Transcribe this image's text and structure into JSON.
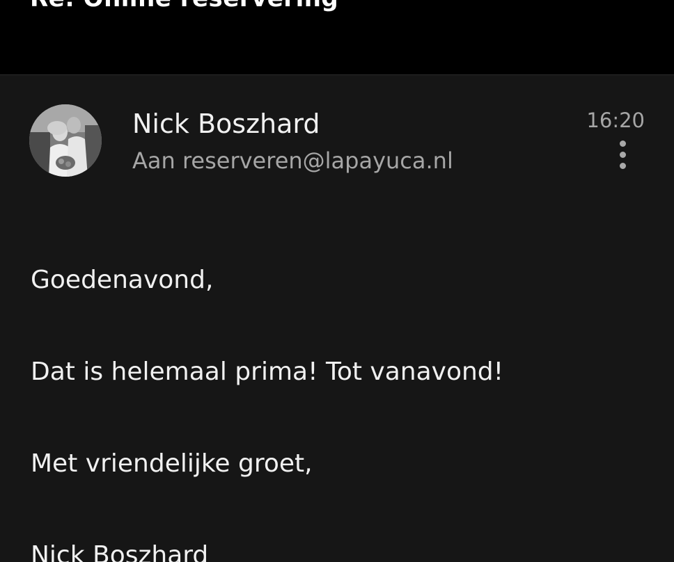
{
  "email": {
    "subject": "Re: Online reservering",
    "sender_name": "Nick Boszhard",
    "recipient": "Aan reserveren@lapayuca.nl",
    "time": "16:20",
    "body": {
      "greeting": "Goedenavond,",
      "message": "Dat is helemaal prima! Tot vanavond!",
      "closing": "Met vriendelijke groet,",
      "signature": "Nick Boszhard"
    }
  },
  "icons": {
    "more": "more-vertical-icon",
    "avatar": "avatar-photo"
  },
  "colors": {
    "background": "#161616",
    "topbar": "#000000",
    "primary_text": "#f1f1f1",
    "secondary_text": "#a6a6a6"
  }
}
